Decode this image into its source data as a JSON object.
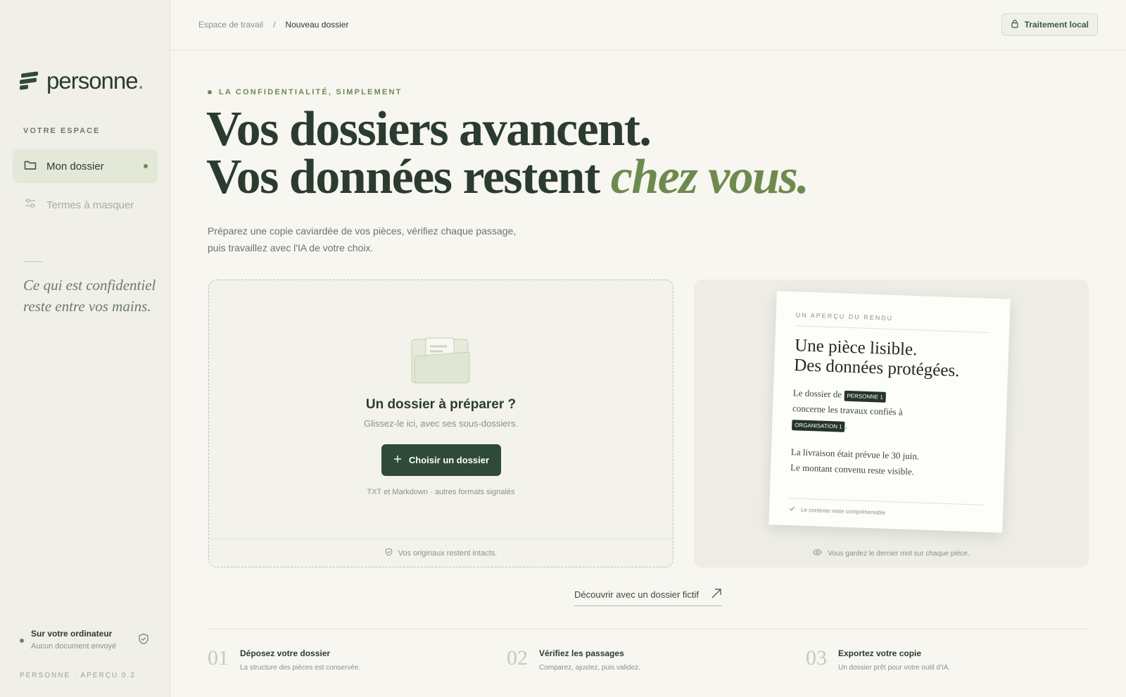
{
  "app": {
    "logo_text": "personne",
    "logo_dot": ".",
    "version": "PERSONNE · APERÇU 0.2"
  },
  "sidebar": {
    "section_label": "VOTRE ESPACE",
    "items": [
      {
        "label": "Mon dossier",
        "icon": "folder-icon",
        "active": true
      },
      {
        "label": "Termes à masquer",
        "icon": "sliders-icon",
        "active": false
      }
    ],
    "quote": "Ce qui est confidentiel reste entre vos mains.",
    "status": {
      "title": "Sur votre ordinateur",
      "subtitle": "Aucun document envoyé"
    }
  },
  "header": {
    "breadcrumb": [
      "Espace de travail",
      "/",
      "Nouveau dossier"
    ],
    "badge_label": "Traitement local"
  },
  "hero": {
    "eyebrow": "LA CONFIDENTIALITÉ, SIMPLEMENT",
    "headline_line1": "Vos dossiers avancent.",
    "headline_line2": "Vos données restent ",
    "headline_emphasis": "chez vous.",
    "intro_line1": "Préparez une copie caviardée de vos pièces, vérifiez chaque passage,",
    "intro_line2": "puis travaillez avec l'IA de votre choix."
  },
  "dropzone": {
    "title": "Un dossier à préparer ?",
    "subtitle": "Glissez-le ici, avec ses sous-dossiers.",
    "button_label": "Choisir un dossier",
    "formats": "TXT et Markdown · autres formats signalés",
    "footer": "Vos originaux restent intacts."
  },
  "preview": {
    "label": "UN APERÇU DU RENDU",
    "title_line1": "Une pièce lisible.",
    "title_line2": "Des données protégées.",
    "body_a": "Le dossier de",
    "tag_person": "PERSONNE 1",
    "body_b": "concerne les travaux confiés à",
    "tag_org": "ORGANISATION 1",
    "body_c": ".",
    "body2_line1": "La livraison était prévue le 30 juin.",
    "body2_line2": "Le montant convenu reste visible.",
    "footer": "Le contexte reste compréhensible",
    "caption": "Vous gardez le dernier mot sur chaque pièce."
  },
  "discover": {
    "label": "Découvrir avec un dossier fictif"
  },
  "steps": [
    {
      "num": "01",
      "title": "Déposez votre dossier",
      "subtitle": "La structure des pièces est conservée."
    },
    {
      "num": "02",
      "title": "Vérifiez les passages",
      "subtitle": "Comparez, ajustez, puis validez."
    },
    {
      "num": "03",
      "title": "Exportez votre copie",
      "subtitle": "Un dossier prêt pour votre outil d'IA."
    }
  ],
  "colors": {
    "accent": "#6f8a4e",
    "primary": "#2f4a38",
    "background": "#f7f6f1",
    "sidebar": "#f0efe8"
  }
}
